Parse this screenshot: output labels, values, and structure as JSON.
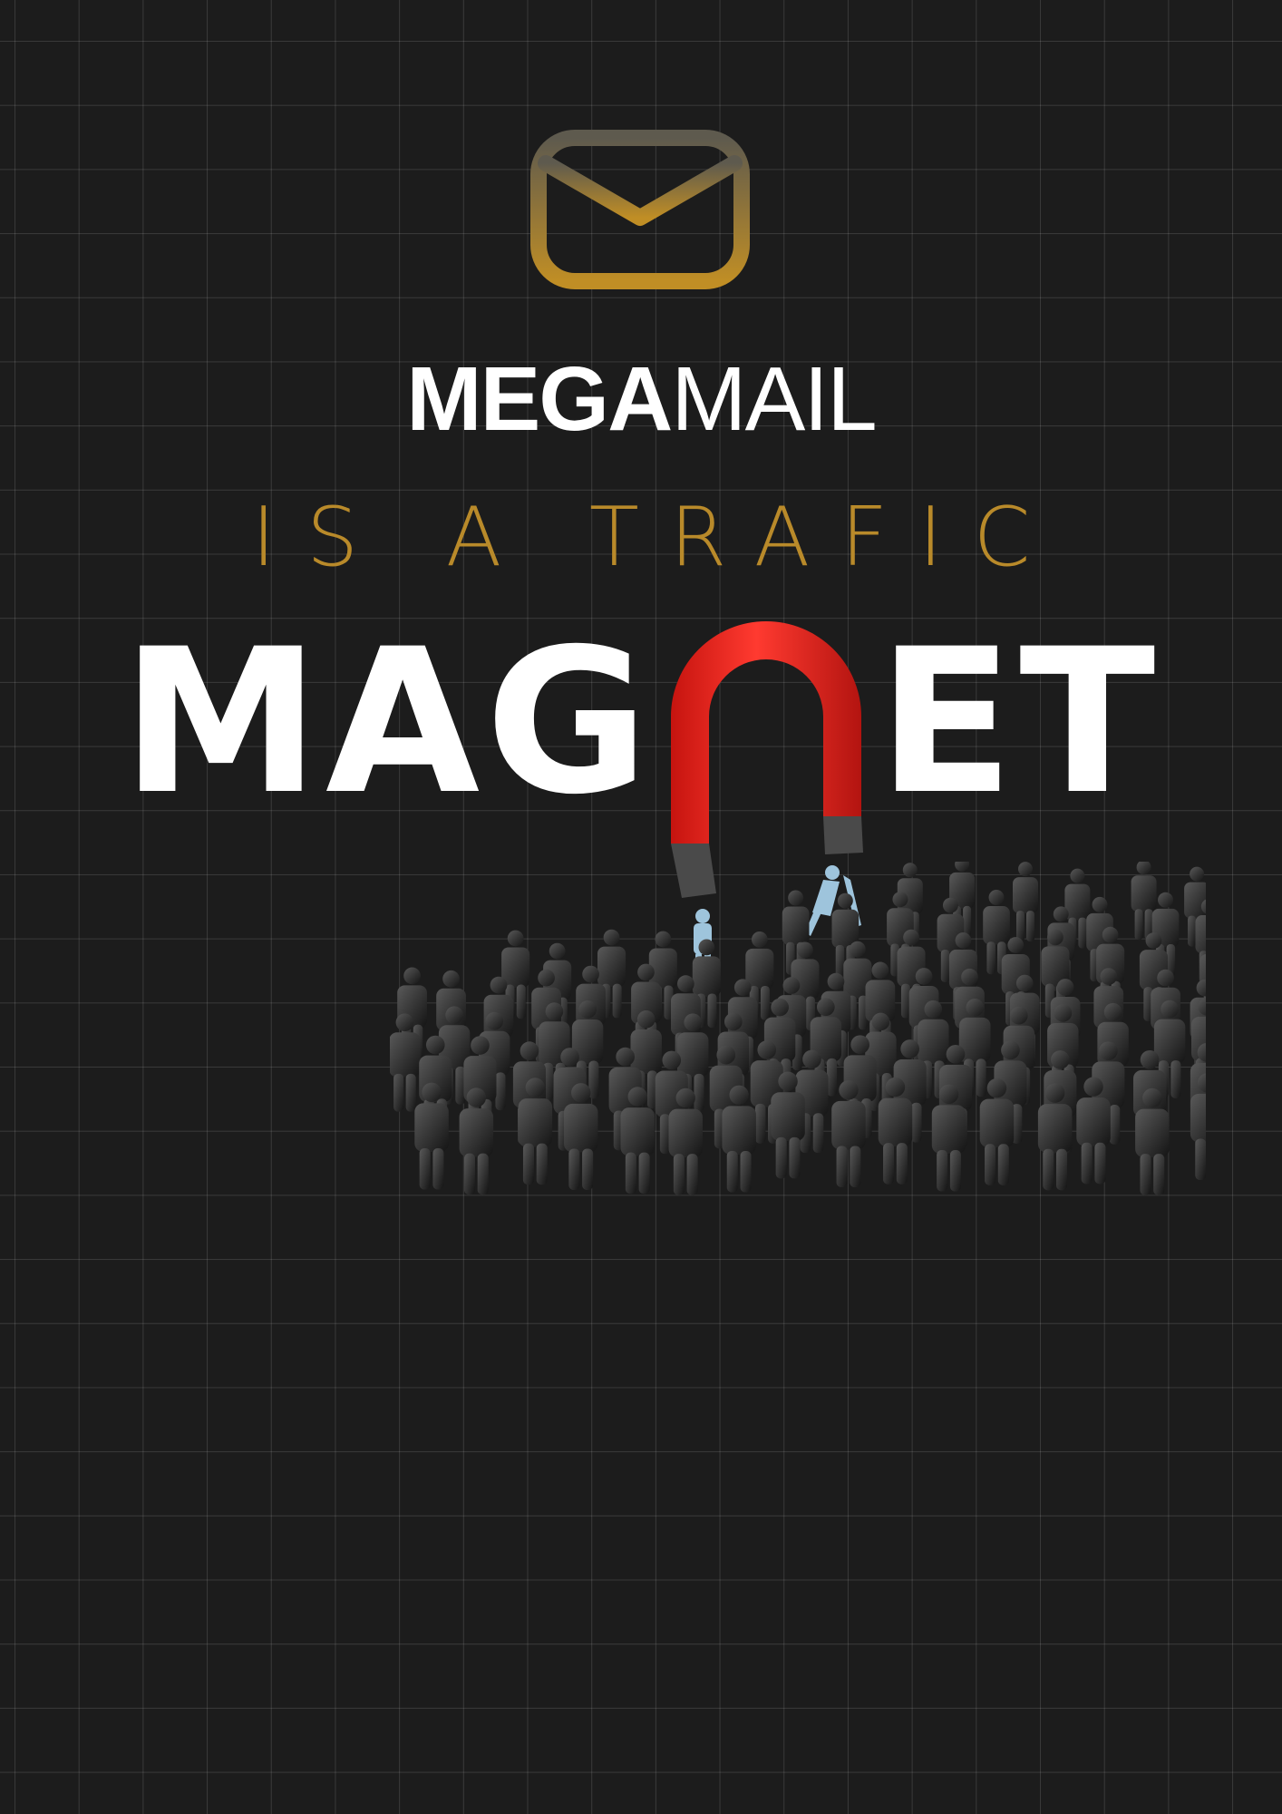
{
  "logo": {
    "icon": "m-logo-icon",
    "color_top": "#5e5a4e",
    "color_bottom": "#c08e25"
  },
  "brand": {
    "bold": "MEGA",
    "light": "MAIL"
  },
  "tagline": "IS A TRAFIC",
  "headline": {
    "left": "MAG",
    "right": "ET"
  },
  "illustration": {
    "magnet": "horseshoe-magnet-icon",
    "magnet_color": "#e8231e",
    "people_icon": "people-crowd-icon",
    "attracted_color": "#9ec4dc"
  },
  "colors": {
    "background": "#1c1c1c",
    "gold": "#b98a2a",
    "white": "#ffffff"
  }
}
